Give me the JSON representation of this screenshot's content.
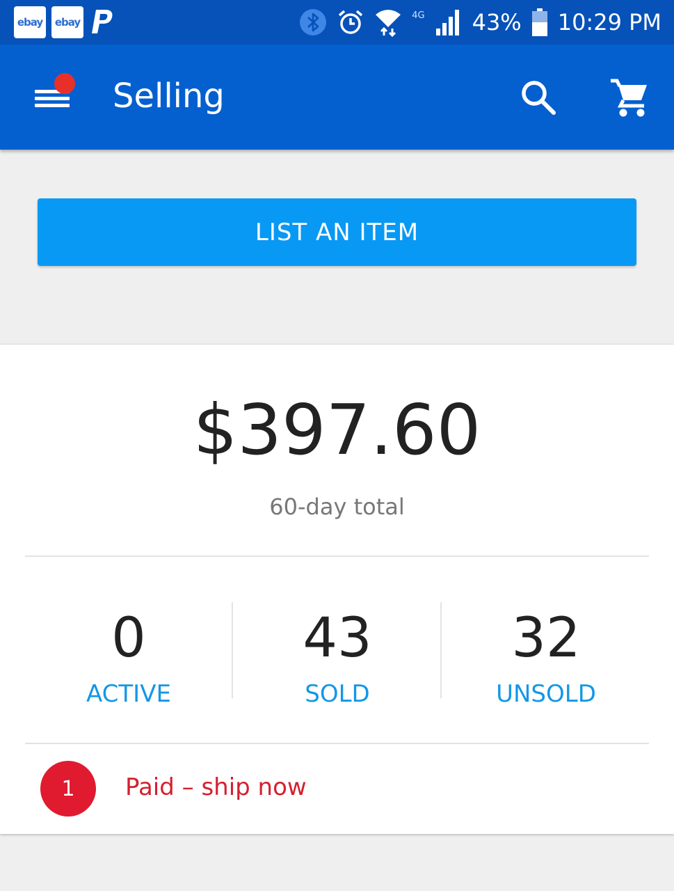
{
  "status_bar": {
    "apps": [
      "ebay",
      "ebay"
    ],
    "network": "4G",
    "battery_percent": "43%",
    "time": "10:29 PM"
  },
  "app_bar": {
    "title": "Selling"
  },
  "actions": {
    "list_item_label": "LIST AN ITEM"
  },
  "summary": {
    "total_amount": "$397.60",
    "total_label": "60-day total"
  },
  "stats": [
    {
      "value": "0",
      "label": "ACTIVE"
    },
    {
      "value": "43",
      "label": "SOLD"
    },
    {
      "value": "32",
      "label": "UNSOLD"
    }
  ],
  "ship_now": {
    "count": "1",
    "label": "Paid – ship now"
  },
  "colors": {
    "status_bar": "#0652b8",
    "app_bar": "#0560cf",
    "primary_button": "#0899f5",
    "stat_label": "#1497e6",
    "alert": "#e01a2f",
    "notification_dot": "#e8302a"
  }
}
